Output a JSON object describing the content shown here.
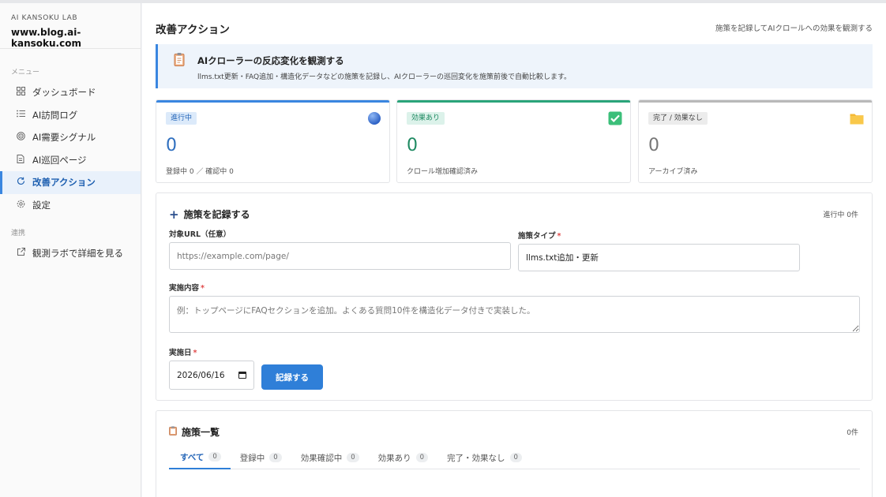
{
  "sidebar": {
    "brand_sub": "AI KANSOKU LAB",
    "domain": "www.blog.ai-kansoku.com",
    "menu_heading": "メニュー",
    "items": [
      {
        "label": "ダッシュボード",
        "icon": "grid-icon"
      },
      {
        "label": "AI訪問ログ",
        "icon": "list-icon"
      },
      {
        "label": "AI需要シグナル",
        "icon": "signal-icon"
      },
      {
        "label": "AI巡回ページ",
        "icon": "document-icon"
      },
      {
        "label": "改善アクション",
        "icon": "refresh-icon",
        "active": true
      },
      {
        "label": "設定",
        "icon": "gear-icon"
      }
    ],
    "link_heading": "連携",
    "external_link": {
      "label": "観測ラボで詳細を見る",
      "icon": "external-link-icon"
    }
  },
  "header": {
    "title": "改善アクション",
    "hint": "施策を記録してAIクロールへの効果を観測する"
  },
  "banner": {
    "title": "AIクローラーの反応変化を観測する",
    "description": "llms.txt更新・FAQ追加・構造化データなどの施策を記録し、AIクローラーの巡回変化を施策前後で自動比較します。",
    "icon": "clipboard-icon"
  },
  "stats": [
    {
      "badge": "進行中",
      "value": "0",
      "sub": "登録中 0 ／ 確認中 0",
      "icon": "blue-circle-icon",
      "color": "#3a86e0"
    },
    {
      "badge": "効果あり",
      "value": "0",
      "sub": "クロール増加確認済み",
      "icon": "check-box-icon",
      "color": "#2aa47a"
    },
    {
      "badge": "完了 / 効果なし",
      "value": "0",
      "sub": "アーカイブ済み",
      "icon": "folder-icon",
      "color": "#b9b9b9"
    }
  ],
  "form": {
    "title": "施策を記録する",
    "status": "進行中 0件",
    "url_label": "対象URL（任意）",
    "url_placeholder": "https://example.com/page/",
    "type_label": "施策タイプ",
    "type_value": "llms.txt追加・更新",
    "content_label": "実施内容",
    "content_placeholder": "例：トップページにFAQセクションを追加。よくある質問10件を構造化データ付きで実装した。",
    "date_label": "実施日",
    "date_value": "2026/06/16",
    "required_mark": "*",
    "submit_label": "記録する"
  },
  "list": {
    "title": "施策一覧",
    "count": "0件",
    "tabs": [
      {
        "label": "すべて",
        "count": "0",
        "active": true
      },
      {
        "label": "登録中",
        "count": "0"
      },
      {
        "label": "効果確認中",
        "count": "0"
      },
      {
        "label": "効果あり",
        "count": "0"
      },
      {
        "label": "完了・効果なし",
        "count": "0"
      }
    ]
  },
  "colors": {
    "accent": "#3a86e0",
    "success": "#2aa47a",
    "neutral": "#b9b9b9",
    "required": "#e14a4a",
    "button": "#2f7fd8"
  }
}
